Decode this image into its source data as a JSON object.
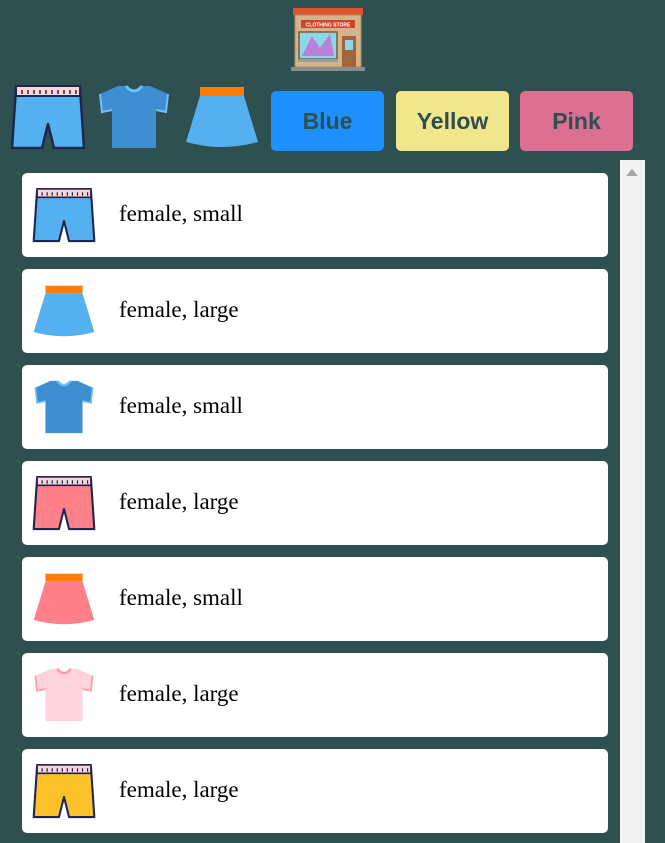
{
  "header": {
    "logo_icon": "clothing-store-icon",
    "logo_text": "CLOTHING STORE"
  },
  "filters": {
    "types": [
      {
        "icon": "shorts-icon"
      },
      {
        "icon": "tshirt-icon"
      },
      {
        "icon": "skirt-icon"
      }
    ],
    "colors": [
      {
        "label": "Blue",
        "color": "#1e90ff"
      },
      {
        "label": "Yellow",
        "color": "#f0e68c"
      },
      {
        "label": "Pink",
        "color": "#db7093"
      }
    ]
  },
  "items": [
    {
      "label": "female, small",
      "type": "shorts",
      "color": "#55b0f0"
    },
    {
      "label": "female, large",
      "type": "skirt",
      "color": "#55b0f0"
    },
    {
      "label": "female, small",
      "type": "tshirt",
      "color": "#3d8fd1"
    },
    {
      "label": "female, large",
      "type": "shorts",
      "color": "#ff8089"
    },
    {
      "label": "female, small",
      "type": "skirt",
      "color": "#ff8089"
    },
    {
      "label": "female, large",
      "type": "tshirt",
      "color": "#ffd3da"
    },
    {
      "label": "female, large",
      "type": "shorts",
      "color": "#fdc22a"
    }
  ]
}
